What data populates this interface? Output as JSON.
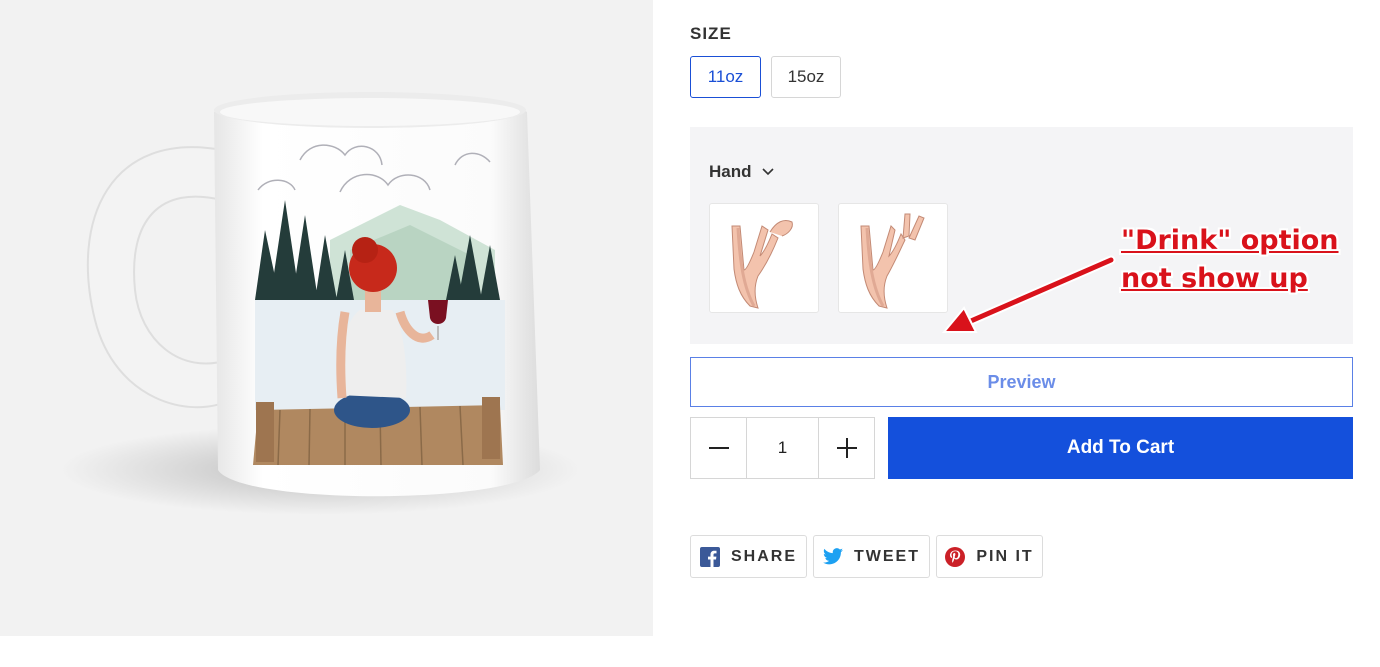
{
  "product": {
    "size_label": "SIZE",
    "sizes": [
      {
        "label": "11oz",
        "selected": true
      },
      {
        "label": "15oz",
        "selected": false
      }
    ],
    "hand_option": {
      "label": "Hand",
      "swatches": [
        "rock-hand",
        "peace-hand"
      ]
    },
    "preview_label": "Preview",
    "quantity": "1",
    "add_to_cart_label": "Add To Cart"
  },
  "annotation": {
    "line1": "\"Drink\" option",
    "line2": "not show up"
  },
  "share": {
    "facebook_label": "SHARE",
    "twitter_label": "TWEET",
    "pinterest_label": "PIN IT"
  },
  "colors": {
    "accent": "#1450dc",
    "annotation": "#d9121b",
    "facebook": "#3b5998",
    "twitter": "#1da1f2",
    "pinterest": "#cb2027"
  }
}
